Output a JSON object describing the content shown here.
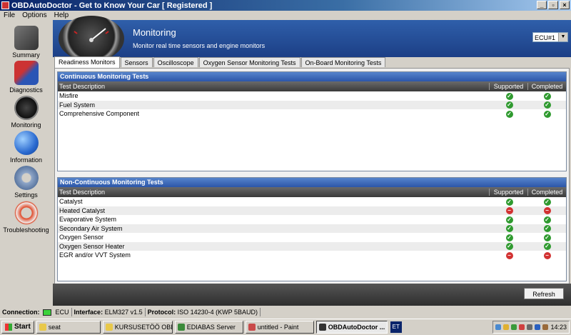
{
  "window": {
    "title": "OBDAutoDoctor - Get to Know Your Car [ Registered ]"
  },
  "menu": [
    "File",
    "Options",
    "Help"
  ],
  "sidebar": {
    "items": [
      {
        "label": "Summary",
        "icon": "summary-icon"
      },
      {
        "label": "Diagnostics",
        "icon": "diagnostics-icon"
      },
      {
        "label": "Monitoring",
        "icon": "gauge-icon"
      },
      {
        "label": "Information",
        "icon": "globe-icon"
      },
      {
        "label": "Settings",
        "icon": "gears-icon"
      },
      {
        "label": "Troubleshooting",
        "icon": "lifebuoy-icon"
      }
    ]
  },
  "header": {
    "title": "Monitoring",
    "subtitle": "Monitor real time sensors and engine monitors",
    "ecu_select": "ECU#1"
  },
  "tabs": [
    "Readiness Monitors",
    "Sensors",
    "Oscilloscope",
    "Oxygen Sensor Monitoring Tests",
    "On-Board Monitoring Tests"
  ],
  "continuous": {
    "title": "Continuous Monitoring Tests",
    "columns": [
      "Test Description",
      "Supported",
      "Completed"
    ],
    "rows": [
      {
        "name": "Misfire",
        "supported": "ok",
        "completed": "ok"
      },
      {
        "name": "Fuel System",
        "supported": "ok",
        "completed": "ok"
      },
      {
        "name": "Comprehensive Component",
        "supported": "ok",
        "completed": "ok"
      }
    ]
  },
  "noncontinuous": {
    "title": "Non-Continuous Monitoring Tests",
    "columns": [
      "Test Description",
      "Supported",
      "Completed"
    ],
    "rows": [
      {
        "name": "Catalyst",
        "supported": "ok",
        "completed": "ok"
      },
      {
        "name": "Heated Catalyst",
        "supported": "no",
        "completed": "no"
      },
      {
        "name": "Evaporative System",
        "supported": "ok",
        "completed": "ok"
      },
      {
        "name": "Secondary Air System",
        "supported": "ok",
        "completed": "ok"
      },
      {
        "name": "Oxygen Sensor",
        "supported": "ok",
        "completed": "ok"
      },
      {
        "name": "Oxygen Sensor Heater",
        "supported": "ok",
        "completed": "ok"
      },
      {
        "name": "EGR and/or VVT System",
        "supported": "no",
        "completed": "no"
      }
    ]
  },
  "refresh_label": "Refresh",
  "statusbar": {
    "connection_label": "Connection:",
    "connection_value": "ECU",
    "interface_label": "Interface:",
    "interface_value": "ELM327 v1.5",
    "protocol_label": "Protocol:",
    "protocol_value": "ISO 14230-4 (KWP 5BAUD)"
  },
  "taskbar": {
    "start": "Start",
    "buttons": [
      "seat",
      "KURSUSETÖÖ OBD",
      "EDIABAS Server",
      "untitled - Paint",
      "OBDAutoDoctor ..."
    ],
    "lang": "ET",
    "clock": "14:23"
  },
  "colors": {
    "ok": "#2f9a2f",
    "no": "#d23232",
    "header": "#2a50a0"
  }
}
